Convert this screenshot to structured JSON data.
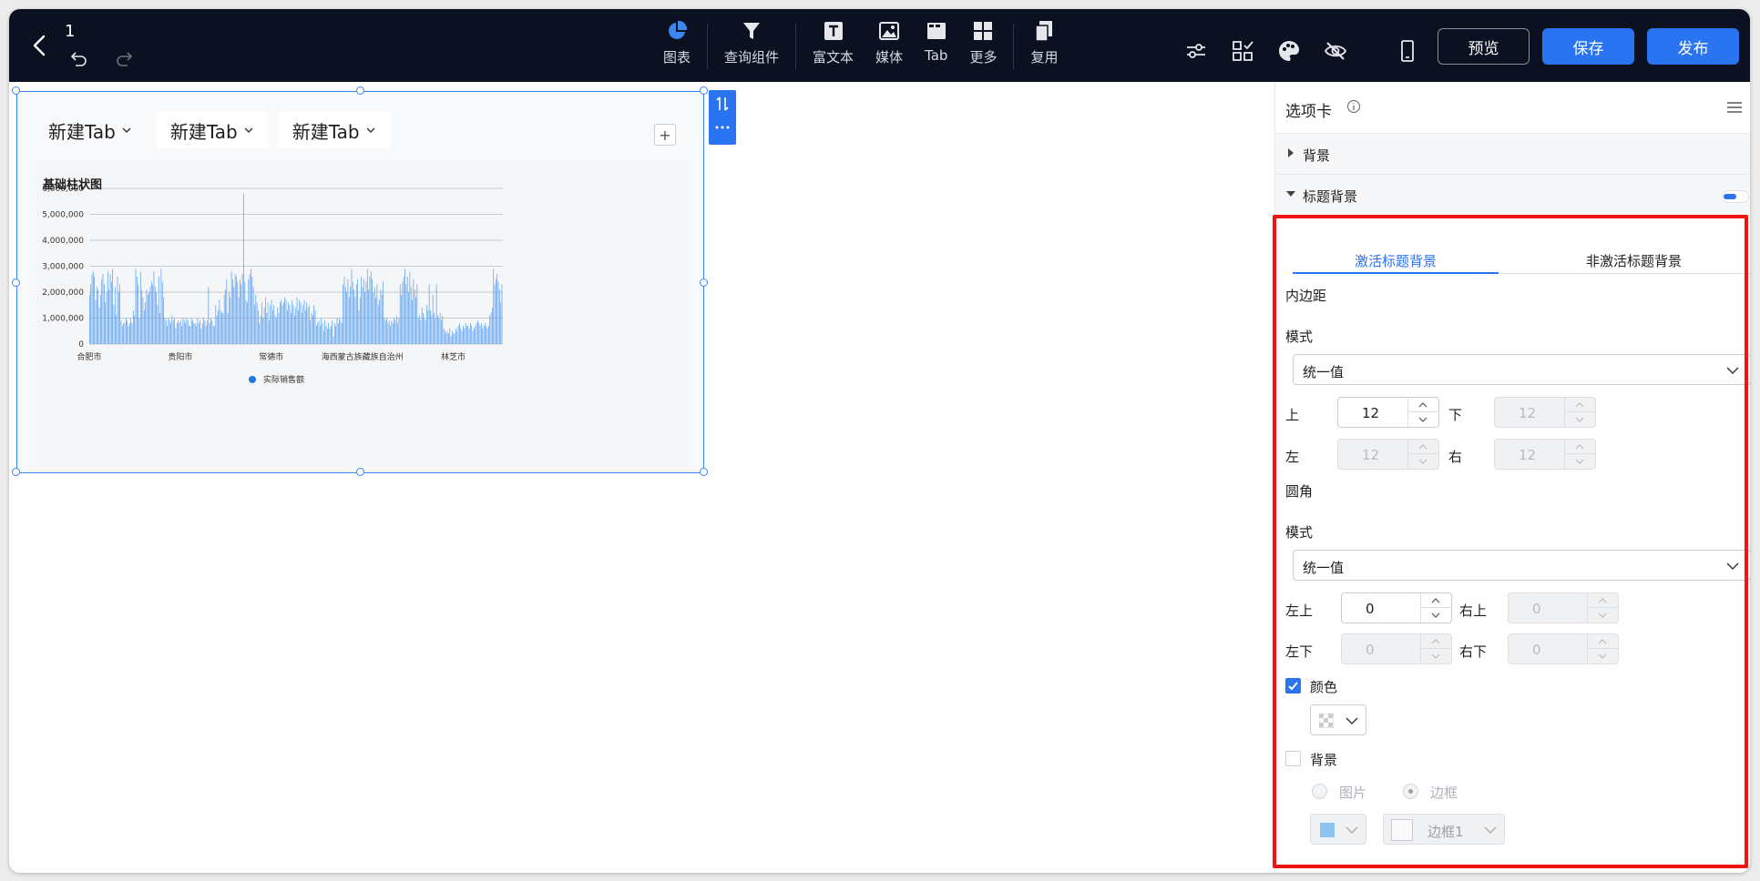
{
  "app": {
    "title": "1"
  },
  "toolbar": {
    "tools": [
      {
        "name": "chart",
        "label": "图表"
      },
      {
        "name": "query",
        "label": "查询组件"
      },
      {
        "name": "richtext",
        "label": "富文本"
      },
      {
        "name": "media",
        "label": "媒体"
      },
      {
        "name": "tab",
        "label": "Tab"
      },
      {
        "name": "more",
        "label": "更多"
      },
      {
        "name": "reuse",
        "label": "复用"
      }
    ],
    "preview_label": "预览",
    "save_label": "保存",
    "publish_label": "发布"
  },
  "canvas": {
    "tabs": [
      {
        "label": "新建Tab"
      },
      {
        "label": "新建Tab"
      },
      {
        "label": "新建Tab"
      }
    ],
    "add_tab_label": "+"
  },
  "chart_data": {
    "type": "bar",
    "title": "基础柱状图",
    "xlabel": "",
    "ylabel": "",
    "ylim": [
      0,
      6000000
    ],
    "y_ticks": [
      "6,000,000",
      "5,000,000",
      "4,000,000",
      "3,000,000",
      "2,000,000",
      "1,000,000",
      "0"
    ],
    "x_tick_labels": [
      "合肥市",
      "贵阳市",
      "常德市",
      "海西蒙古族藏族自治州",
      "林芝市"
    ],
    "legend": [
      "实际销售额"
    ],
    "legend_position": "bottom",
    "grid": true,
    "series": [
      {
        "name": "实际销售额",
        "color": "#5aa0ef",
        "values": [
          1900000,
          2300000,
          2700000,
          2800000,
          2600000,
          1700000,
          2200000,
          2100000,
          1400000,
          1900000,
          2500000,
          2700000,
          2300000,
          1600000,
          2000000,
          2800000,
          2100000,
          2700000,
          2400000,
          2900000,
          1500000,
          2200000,
          1100000,
          2600000,
          2000000,
          2300000,
          900000,
          700000,
          800000,
          800000,
          1000000,
          900000,
          700000,
          800000,
          1000000,
          800000,
          1300000,
          1100000,
          2900000,
          2600000,
          2300000,
          1000000,
          2800000,
          2100000,
          1800000,
          1300000,
          1600000,
          2100000,
          1900000,
          2000000,
          2200000,
          2400000,
          2300000,
          2800000,
          2200000,
          2000000,
          1500000,
          2600000,
          1200000,
          2900000,
          2400000,
          1800000,
          1000000,
          900000,
          700000,
          1000000,
          900000,
          800000,
          1100000,
          900000,
          1000000,
          600000,
          800000,
          900000,
          800000,
          900000,
          700000,
          1000000,
          900000,
          800000,
          1000000,
          900000,
          700000,
          700000,
          1000000,
          900000,
          800000,
          800000,
          700000,
          1000000,
          800000,
          900000,
          600000,
          800000,
          1000000,
          900000,
          700000,
          900000,
          2200000,
          800000,
          1000000,
          900000,
          700000,
          700000,
          1500000,
          1100000,
          1300000,
          1700000,
          1300000,
          1200000,
          1200000,
          1900000,
          2100000,
          2500000,
          1200000,
          2000000,
          1800000,
          2800000,
          2500000,
          2200000,
          2700000,
          2600000,
          2400000,
          1800000,
          2500000,
          2300000,
          2700000,
          5800000,
          2400000,
          1700000,
          1600000,
          2500000,
          2700000,
          2900000,
          2600000,
          2200000,
          1500000,
          1900000,
          1600000,
          1300000,
          800000,
          1100000,
          1600000,
          1000000,
          1400000,
          1800000,
          1200000,
          1600000,
          900000,
          1500000,
          1700000,
          1300000,
          1500000,
          1100000,
          1000000,
          1400000,
          1200000,
          1600000,
          1700000,
          1500000,
          1600000,
          1800000,
          1700000,
          1300000,
          1600000,
          1500000,
          1200000,
          1700000,
          1500000,
          1100000,
          1400000,
          1800000,
          1300000,
          1700000,
          1600000,
          1200000,
          1500000,
          1700000,
          1300000,
          1600000,
          1400000,
          1500000,
          900000,
          1200000,
          1100000,
          1500000,
          1300000,
          700000,
          800000,
          900000,
          700000,
          1000000,
          800000,
          500000,
          900000,
          700000,
          600000,
          800000,
          600000,
          700000,
          900000,
          300000,
          800000,
          700000,
          1000000,
          800000,
          1000000,
          900000,
          800000,
          2300000,
          2600000,
          2200000,
          2000000,
          2500000,
          1800000,
          2200000,
          2900000,
          2400000,
          2100000,
          1800000,
          2300000,
          2500000,
          1300000,
          1800000,
          2600000,
          2200000,
          2500000,
          2000000,
          2400000,
          2900000,
          2100000,
          2600000,
          2800000,
          2500000,
          2000000,
          2200000,
          1800000,
          2300000,
          1500000,
          1700000,
          2100000,
          1900000,
          2400000,
          1000000,
          900000,
          1000000,
          800000,
          900000,
          700000,
          900000,
          800000,
          1000000,
          900000,
          1100000,
          800000,
          1000000,
          2300000,
          1900000,
          2400000,
          2600000,
          2900000,
          2300000,
          2600000,
          2000000,
          2800000,
          2200000,
          1700000,
          2500000,
          2100000,
          1800000,
          2300000,
          1000000,
          1100000,
          900000,
          1400000,
          1200000,
          1000000,
          900000,
          1500000,
          1300000,
          2300000,
          1300000,
          1100000,
          1900000,
          1200000,
          1000000,
          2300000,
          1100000,
          1000000,
          1200000,
          900000,
          1100000,
          600000,
          500000,
          400000,
          500000,
          400000,
          600000,
          300000,
          500000,
          400000,
          400000,
          600000,
          500000,
          700000,
          800000,
          600000,
          500000,
          700000,
          600000,
          800000,
          700000,
          700000,
          600000,
          800000,
          700000,
          500000,
          600000,
          700000,
          800000,
          900000,
          800000,
          700000,
          800000,
          600000,
          700000,
          800000,
          700000,
          600000,
          700000,
          1100000,
          1200000,
          1400000,
          2900000,
          2300000,
          2500000,
          2700000,
          2400000,
          2100000,
          1600000,
          2300000
        ]
      }
    ]
  },
  "panel": {
    "title": "选项卡",
    "sections": {
      "background_label": "背景",
      "title_background_label": "标题背景"
    },
    "subtabs": {
      "active": "激活标题背景",
      "inactive": "非激活标题背景"
    },
    "padding": {
      "heading": "内边距",
      "mode_label": "模式",
      "mode_value": "统一值",
      "top_label": "上",
      "top_value": "12",
      "bottom_label": "下",
      "bottom_value": "12",
      "left_label": "左",
      "left_value": "12",
      "right_label": "右",
      "right_value": "12"
    },
    "radius": {
      "heading": "圆角",
      "mode_label": "模式",
      "mode_value": "统一值",
      "tl_label": "左上",
      "tl_value": "0",
      "tr_label": "右上",
      "tr_value": "0",
      "bl_label": "左下",
      "bl_value": "0",
      "br_label": "右下",
      "br_value": "0"
    },
    "color": {
      "label": "颜色",
      "checked": true
    },
    "background": {
      "label": "背景",
      "checked": false,
      "option_image": "图片",
      "option_border": "边框",
      "selected_option": "边框",
      "border_select_value": "边框1",
      "fill_color": "#8cc4ee"
    }
  },
  "colors": {
    "topbar_bg": "#0c1121",
    "accent": "#2a74f1",
    "highlight": "#ef1313"
  }
}
